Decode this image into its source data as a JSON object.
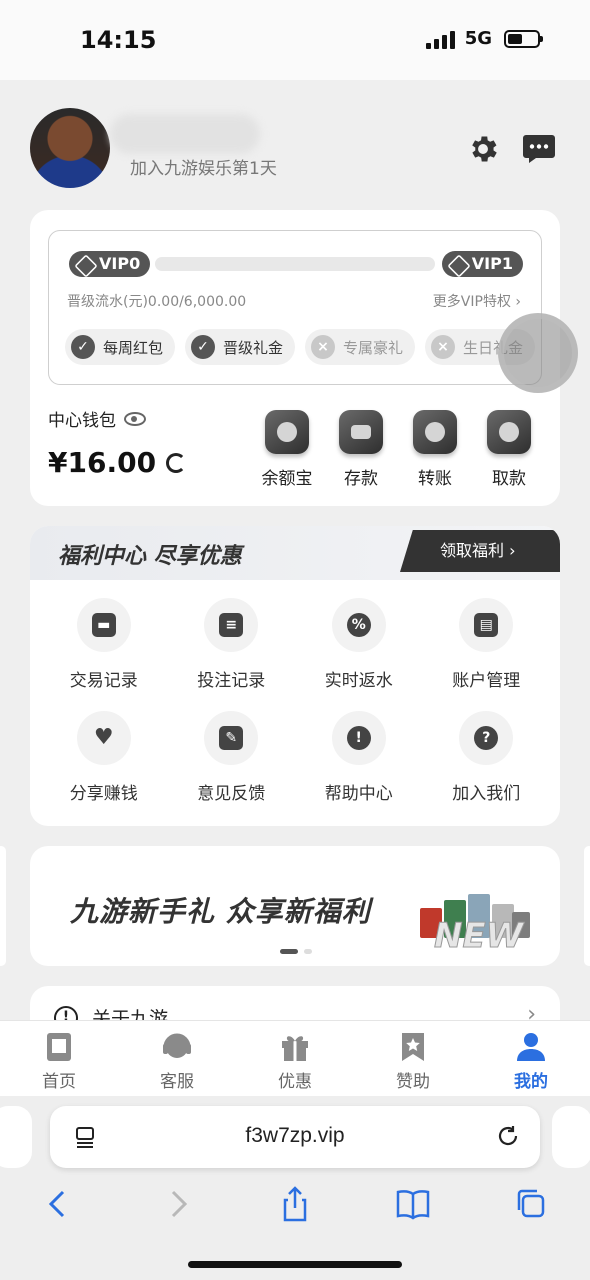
{
  "status": {
    "time": "14:15",
    "network": "5G"
  },
  "profile": {
    "join_text": "加入九游娱乐第1天"
  },
  "vip": {
    "current_level": "VIP0",
    "next_level": "VIP1",
    "progress_fraction": 0.0,
    "progress_text": "晋级流水(元)0.00/6,000.00",
    "more_link": "更多VIP特权 ›",
    "perks": [
      {
        "label": "每周红包",
        "enabled": true,
        "icon": "check-icon"
      },
      {
        "label": "晋级礼金",
        "enabled": true,
        "icon": "check-icon"
      },
      {
        "label": "专属豪礼",
        "enabled": false,
        "icon": "cross-icon"
      },
      {
        "label": "生日礼金",
        "enabled": false,
        "icon": "cross-icon"
      }
    ]
  },
  "wallet": {
    "label": "中心钱包",
    "balance": "¥16.00",
    "actions": [
      {
        "label": "余额宝",
        "icon": "vault-icon"
      },
      {
        "label": "存款",
        "icon": "wallet-icon"
      },
      {
        "label": "转账",
        "icon": "transfer-icon"
      },
      {
        "label": "取款",
        "icon": "withdraw-icon"
      }
    ]
  },
  "benefits": {
    "title": "福利中心 尽享优惠",
    "claim_button": "领取福利 ›",
    "items": [
      {
        "label": "交易记录",
        "icon": "wallet-icon",
        "glyph": "▬"
      },
      {
        "label": "投注记录",
        "icon": "calendar-icon",
        "glyph": "≡"
      },
      {
        "label": "实时返水",
        "icon": "percent-badge-icon",
        "glyph": "%"
      },
      {
        "label": "账户管理",
        "icon": "id-card-icon",
        "glyph": "▤"
      },
      {
        "label": "分享赚钱",
        "icon": "handshake-icon",
        "glyph": "♥"
      },
      {
        "label": "意见反馈",
        "icon": "edit-note-icon",
        "glyph": "✎"
      },
      {
        "label": "帮助中心",
        "icon": "alert-icon",
        "glyph": "!"
      },
      {
        "label": "加入我们",
        "icon": "question-icon",
        "glyph": "?"
      }
    ]
  },
  "banner": {
    "text": "九游新手礼 众享新福利",
    "badge": "NEW"
  },
  "about": {
    "label": "关于九游",
    "arrow": "›"
  },
  "tabbar": {
    "tabs": [
      {
        "label": "首页",
        "icon": "home-doc-icon",
        "active": false
      },
      {
        "label": "客服",
        "icon": "headset-icon",
        "active": false
      },
      {
        "label": "优惠",
        "icon": "gift-icon",
        "active": false
      },
      {
        "label": "赞助",
        "icon": "star-bookmark-icon",
        "active": false
      },
      {
        "label": "我的",
        "icon": "user-icon",
        "active": true
      }
    ]
  },
  "browser": {
    "url": "f3w7zp.vip"
  },
  "colors": {
    "accent": "#2b6fe0",
    "dark": "#333333",
    "background": "#efefef"
  }
}
